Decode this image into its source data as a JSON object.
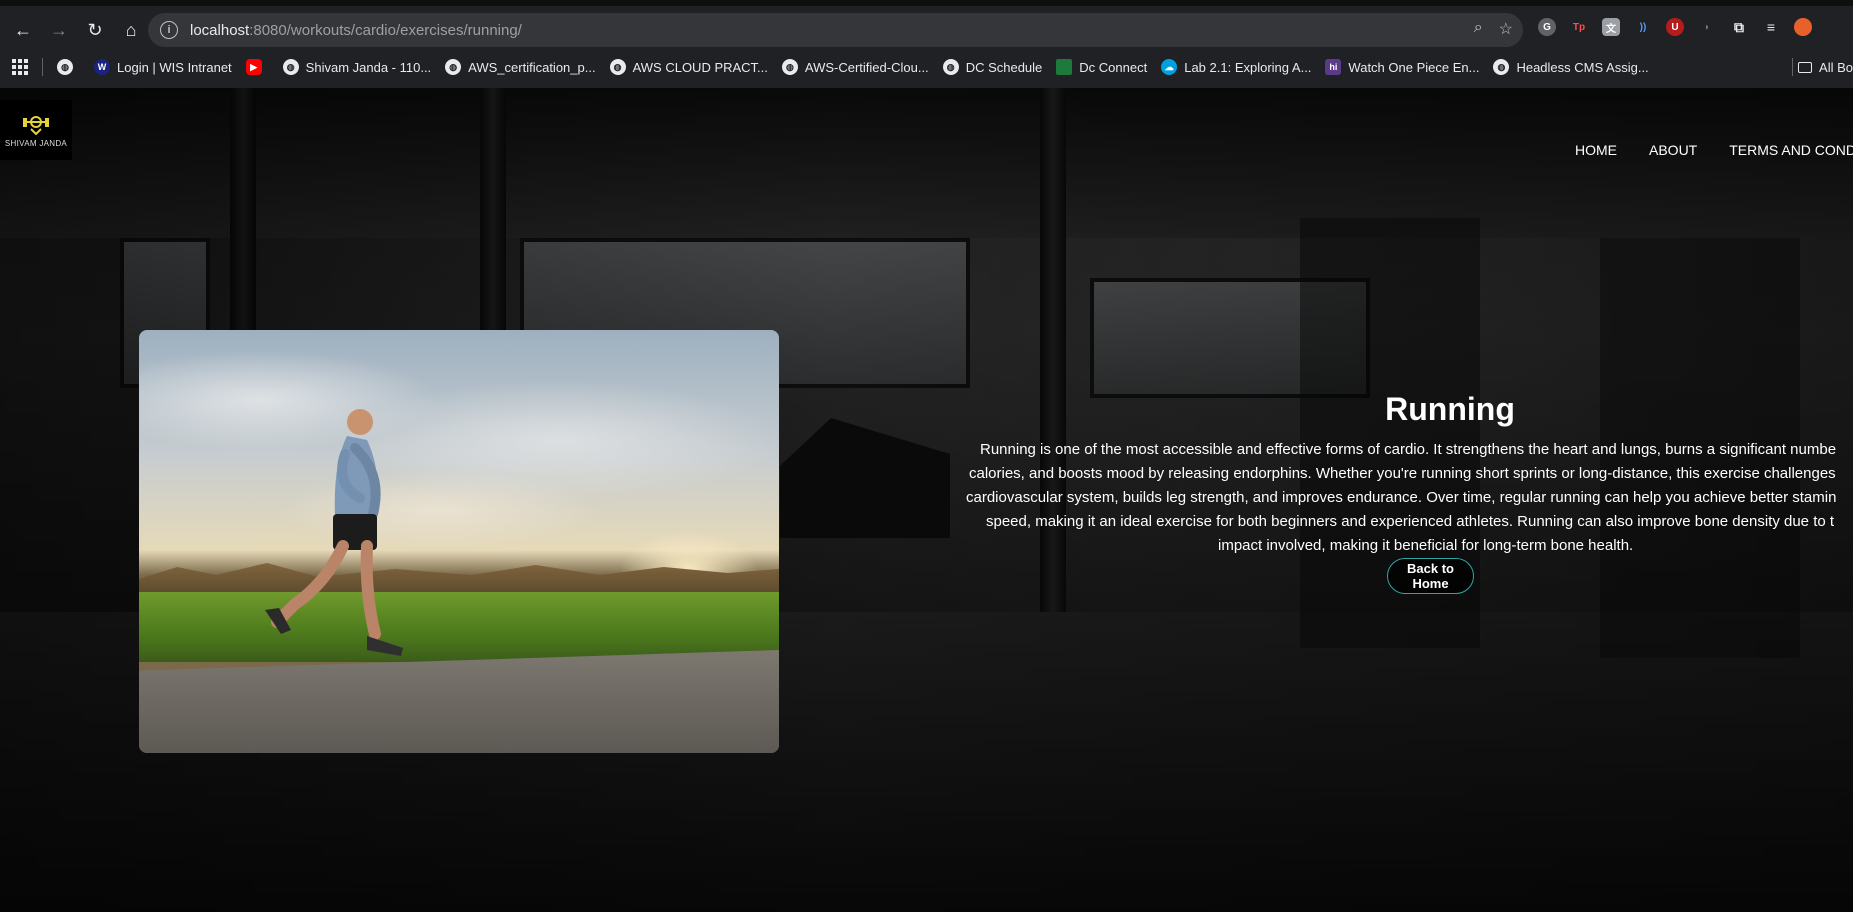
{
  "browser": {
    "url_host": "localhost",
    "url_rest": ":8080/workouts/cardio/exercises/running/",
    "bookmarks": [
      {
        "label": "",
        "icon": "globe-icon",
        "color": "#e8eaed"
      },
      {
        "label": "Login | WIS Intranet",
        "icon": "wis-icon",
        "color": "#1a237e"
      },
      {
        "label": "",
        "icon": "youtube-icon",
        "color": "#ff0000"
      },
      {
        "label": "Shivam Janda - 110...",
        "icon": "globe-icon",
        "color": "#e8eaed"
      },
      {
        "label": "AWS_certification_p...",
        "icon": "globe-icon",
        "color": "#e8eaed"
      },
      {
        "label": "AWS CLOUD PRACT...",
        "icon": "globe-icon",
        "color": "#e8eaed"
      },
      {
        "label": "AWS-Certified-Clou...",
        "icon": "globe-icon",
        "color": "#e8eaed"
      },
      {
        "label": "DC  Schedule",
        "icon": "globe-icon",
        "color": "#e8eaed"
      },
      {
        "label": "Dc Connect",
        "icon": "dc-icon",
        "color": "#1e7a3a"
      },
      {
        "label": "Lab 2.1: Exploring A...",
        "icon": "salesforce-icon",
        "color": "#00a1e0"
      },
      {
        "label": "Watch One Piece En...",
        "icon": "hi-icon",
        "color": "#5b3a8a"
      },
      {
        "label": "Headless CMS Assig...",
        "icon": "globe-icon",
        "color": "#e8eaed"
      }
    ],
    "all_bookmarks_label": "All Bo"
  },
  "site": {
    "logo_text": "SHIVAM JANDA",
    "nav": [
      "HOME",
      "ABOUT",
      "TERMS AND CONDITI"
    ]
  },
  "exercise": {
    "title": "Running",
    "paragraph_lines": [
      "Running is one of the most accessible and effective forms of cardio. It strengthens the heart and lungs, burns a significant numbe",
      "calories, and boosts mood by releasing endorphins. Whether you're running short sprints or long-distance, this exercise challenges",
      "cardiovascular system, builds leg strength, and improves endurance. Over time, regular running can help you achieve better stamin",
      "speed, making it an ideal exercise for both beginners and experienced athletes. Running can also improve bone density due to t",
      "impact involved, making it beneficial for long-term bone health."
    ],
    "back_button": "Back to Home"
  },
  "colors": {
    "accent": "#2ea7a0",
    "logo": "#e6d23a"
  }
}
